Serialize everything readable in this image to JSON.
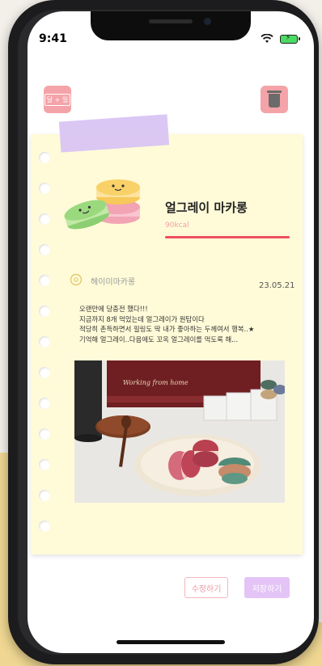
{
  "status": {
    "time": "9:41"
  },
  "top": {
    "left_label": "달 + 일"
  },
  "entry": {
    "title": "얼그레이 마카롱",
    "kcal": "90kcal",
    "kcal_fill_fraction": 1.0,
    "place": "헤이미마카롱",
    "date": "23.05.21",
    "body_lines": [
      "오랜만에 당충전 했다!!!",
      "지금까지 8개 먹었는데 얼그레이가 원탑이다",
      "적당히 촌득하면서 필링도 딱 내가 좋아하는 두께여서 행복..★",
      "기억해 얼그레이..다음에도 꼬옥 얼그레이를 먹도록 해..."
    ],
    "photo_caption": "Working from home"
  },
  "actions": {
    "edit_label": "수정하기",
    "save_label": "저장하기"
  },
  "colors": {
    "note_bg": "#fffbd8",
    "accent_pink": "#f4a3a8",
    "bar_red": "#ee4f5f",
    "save_purple": "#e4c4f6",
    "tape_purple": "#d9c4f3"
  },
  "icons": [
    "wifi-icon",
    "battery-icon",
    "calendar-icon",
    "trash-icon",
    "location-pin-icon"
  ]
}
